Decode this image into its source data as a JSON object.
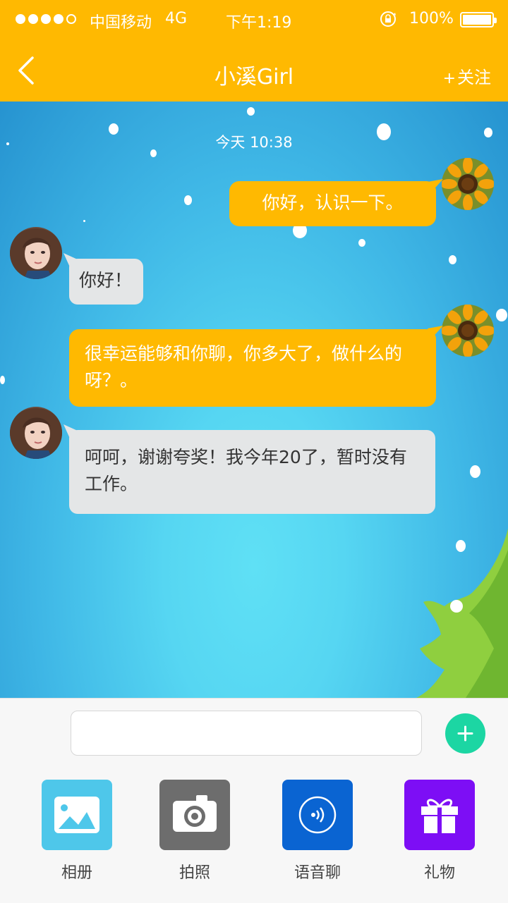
{
  "status_bar": {
    "carrier": "中国移动",
    "network": "4G",
    "time": "下午1:19",
    "battery": "100%",
    "signal_level": 4,
    "battery_level": 1.0
  },
  "nav": {
    "back_icon": "chevron-left-icon",
    "title": "小溪Girl",
    "follow_plus": "+",
    "follow_label": "关注"
  },
  "chat": {
    "timestamp": "今天 10:38",
    "messages": [
      {
        "from": "me",
        "text": "你好，认识一下。"
      },
      {
        "from": "her",
        "text": "你好！"
      },
      {
        "from": "me",
        "text": "很幸运能够和你聊，你多大了，做什么的呀？。"
      },
      {
        "from": "her",
        "text": "呵呵，谢谢夸奖！我今年20了，暂时没有工作。"
      }
    ]
  },
  "composer": {
    "placeholder": "",
    "plus_icon": "plus-icon"
  },
  "tools": [
    {
      "label": "相册",
      "icon": "image-icon",
      "color": "#4ec7ea"
    },
    {
      "label": "拍照",
      "icon": "camera-icon",
      "color": "#6d6d6d"
    },
    {
      "label": "语音聊",
      "icon": "voice-icon",
      "color": "#0a64d2"
    },
    {
      "label": "礼物",
      "icon": "gift-icon",
      "color": "#7d0ef5"
    }
  ],
  "colors": {
    "accent": "#ffb901",
    "bubble_incoming": "#e4e6e7",
    "add_button": "#1cd6a3"
  }
}
